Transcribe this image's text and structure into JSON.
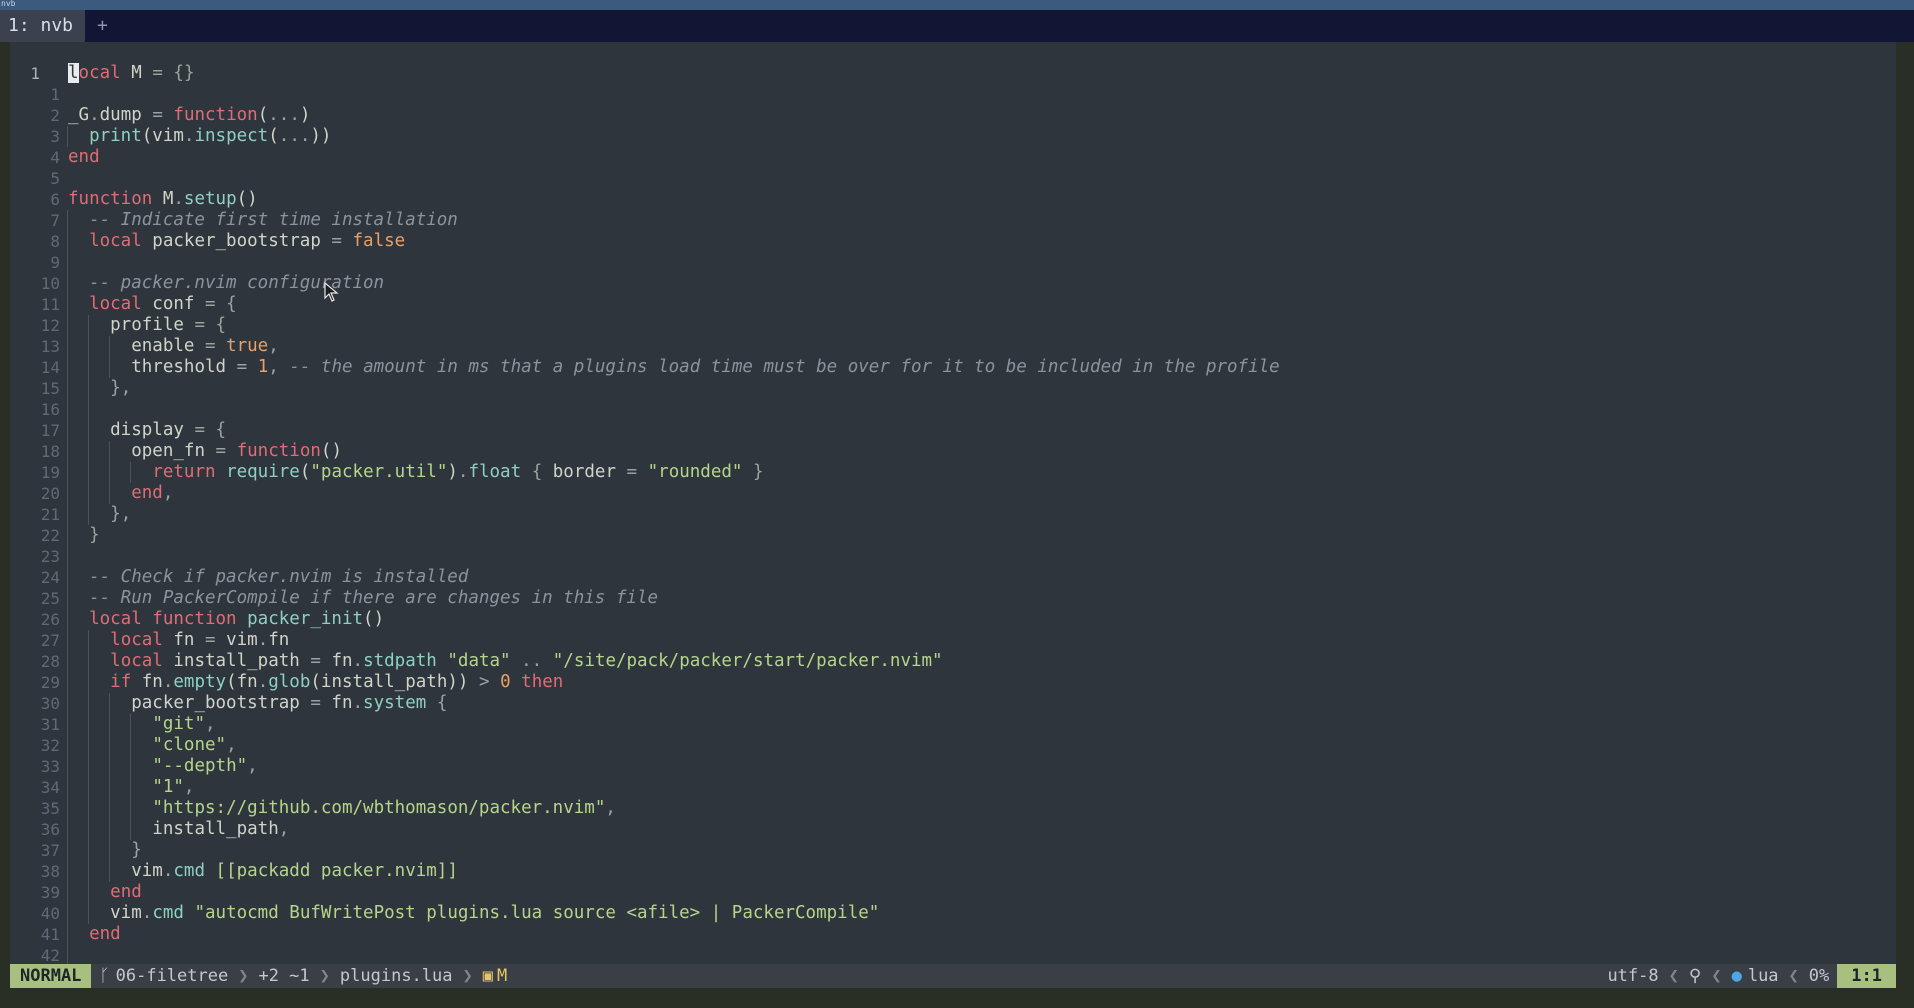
{
  "top_strip": {
    "label": "nvb"
  },
  "tabs": [
    {
      "label": "1: nvb"
    }
  ],
  "new_tab_label": "+",
  "editor": {
    "line_count_visible": 43,
    "cursor": {
      "line": 1,
      "col": 1,
      "char": "l"
    }
  },
  "statusline": {
    "mode": "NORMAL",
    "branch_icon": "git-branch-icon",
    "branch": "06-filetree",
    "diff": "+2 ~1",
    "file": "plugins.lua",
    "modified_icon": "modified-icon",
    "modified_flag": "M",
    "encoding": "utf-8",
    "os_icon": "linux-icon",
    "filetype_icon": "lua-icon",
    "filetype": "lua",
    "percent": "0%",
    "position": "1:1"
  },
  "colors": {
    "keyword": "#e06c75",
    "function": "#8ed2bd",
    "string": "#b5d58b",
    "number": "#e9a06a",
    "comment": "#8b939c",
    "mode_bg": "#a7c080"
  }
}
